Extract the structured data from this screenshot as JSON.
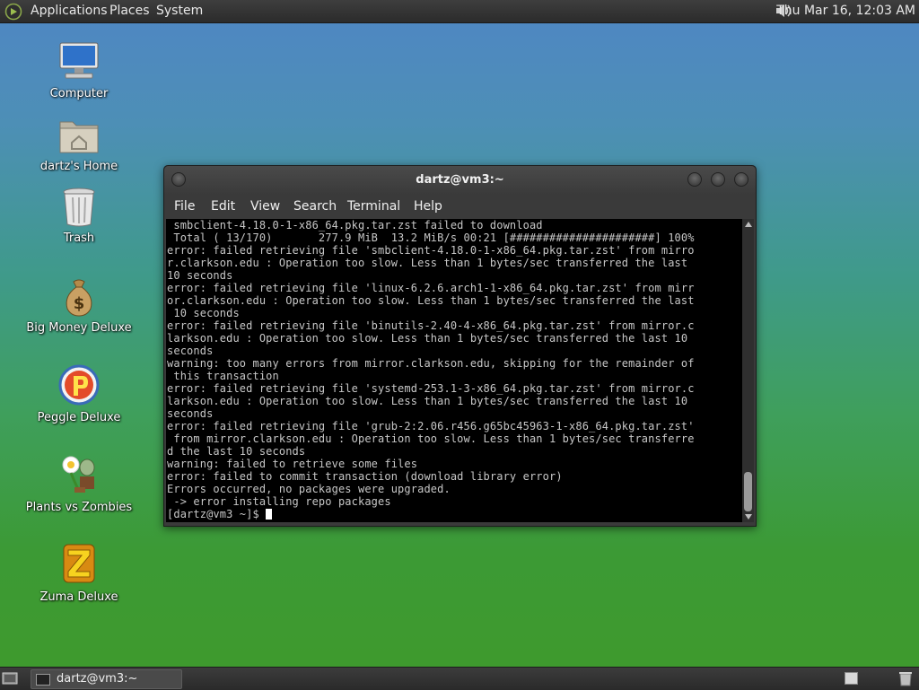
{
  "top_panel": {
    "applications": "Applications",
    "places": "Places",
    "system": "System",
    "clock": "Thu Mar 16, 12:03 AM"
  },
  "desktop_icons": [
    {
      "label": "Computer",
      "icon": "computer-icon"
    },
    {
      "label": "dartz's Home",
      "icon": "home-folder-icon"
    },
    {
      "label": "Trash",
      "icon": "trash-icon"
    },
    {
      "label": "Big Money Deluxe",
      "icon": "money-bag-icon"
    },
    {
      "label": "Peggle Deluxe",
      "icon": "peggle-icon"
    },
    {
      "label": "Plants vs Zombies",
      "icon": "plants-vs-zombies-icon"
    },
    {
      "label": "Zuma Deluxe",
      "icon": "zuma-icon"
    }
  ],
  "terminal": {
    "title": "dartz@vm3:~",
    "menu": [
      "File",
      "Edit",
      "View",
      "Search",
      "Terminal",
      "Help"
    ],
    "lines": [
      " smbclient-4.18.0-1-x86_64.pkg.tar.zst failed to download",
      " Total ( 13/170)       277.9 MiB  13.2 MiB/s 00:21 [######################] 100%",
      "error: failed retrieving file 'smbclient-4.18.0-1-x86_64.pkg.tar.zst' from mirro",
      "r.clarkson.edu : Operation too slow. Less than 1 bytes/sec transferred the last",
      "10 seconds",
      "error: failed retrieving file 'linux-6.2.6.arch1-1-x86_64.pkg.tar.zst' from mirr",
      "or.clarkson.edu : Operation too slow. Less than 1 bytes/sec transferred the last",
      " 10 seconds",
      "error: failed retrieving file 'binutils-2.40-4-x86_64.pkg.tar.zst' from mirror.c",
      "larkson.edu : Operation too slow. Less than 1 bytes/sec transferred the last 10",
      "seconds",
      "warning: too many errors from mirror.clarkson.edu, skipping for the remainder of",
      " this transaction",
      "error: failed retrieving file 'systemd-253.1-3-x86_64.pkg.tar.zst' from mirror.c",
      "larkson.edu : Operation too slow. Less than 1 bytes/sec transferred the last 10",
      "seconds",
      "error: failed retrieving file 'grub-2:2.06.r456.g65bc45963-1-x86_64.pkg.tar.zst'",
      " from mirror.clarkson.edu : Operation too slow. Less than 1 bytes/sec transferre",
      "d the last 10 seconds",
      "warning: failed to retrieve some files",
      "error: failed to commit transaction (download library error)",
      "Errors occurred, no packages were upgraded.",
      " -> error installing repo packages"
    ],
    "prompt": "[dartz@vm3 ~]$ "
  },
  "taskbar": {
    "task_label": "dartz@vm3:~"
  }
}
